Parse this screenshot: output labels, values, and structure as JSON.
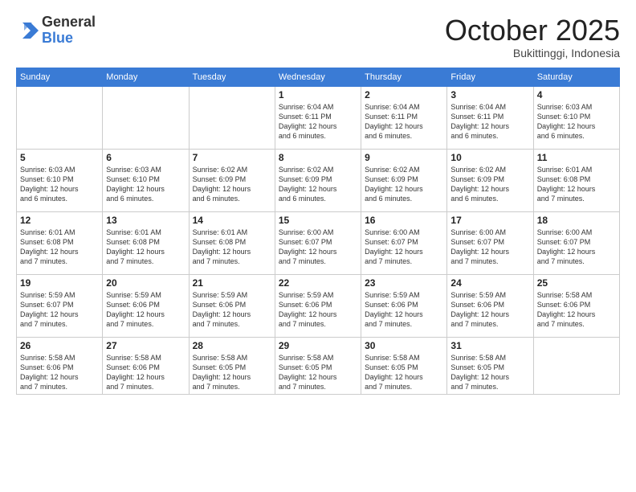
{
  "logo": {
    "general": "General",
    "blue": "Blue"
  },
  "header": {
    "month": "October 2025",
    "location": "Bukittinggi, Indonesia"
  },
  "weekdays": [
    "Sunday",
    "Monday",
    "Tuesday",
    "Wednesday",
    "Thursday",
    "Friday",
    "Saturday"
  ],
  "weeks": [
    [
      {
        "day": "",
        "info": ""
      },
      {
        "day": "",
        "info": ""
      },
      {
        "day": "",
        "info": ""
      },
      {
        "day": "1",
        "info": "Sunrise: 6:04 AM\nSunset: 6:11 PM\nDaylight: 12 hours\nand 6 minutes."
      },
      {
        "day": "2",
        "info": "Sunrise: 6:04 AM\nSunset: 6:11 PM\nDaylight: 12 hours\nand 6 minutes."
      },
      {
        "day": "3",
        "info": "Sunrise: 6:04 AM\nSunset: 6:11 PM\nDaylight: 12 hours\nand 6 minutes."
      },
      {
        "day": "4",
        "info": "Sunrise: 6:03 AM\nSunset: 6:10 PM\nDaylight: 12 hours\nand 6 minutes."
      }
    ],
    [
      {
        "day": "5",
        "info": "Sunrise: 6:03 AM\nSunset: 6:10 PM\nDaylight: 12 hours\nand 6 minutes."
      },
      {
        "day": "6",
        "info": "Sunrise: 6:03 AM\nSunset: 6:10 PM\nDaylight: 12 hours\nand 6 minutes."
      },
      {
        "day": "7",
        "info": "Sunrise: 6:02 AM\nSunset: 6:09 PM\nDaylight: 12 hours\nand 6 minutes."
      },
      {
        "day": "8",
        "info": "Sunrise: 6:02 AM\nSunset: 6:09 PM\nDaylight: 12 hours\nand 6 minutes."
      },
      {
        "day": "9",
        "info": "Sunrise: 6:02 AM\nSunset: 6:09 PM\nDaylight: 12 hours\nand 6 minutes."
      },
      {
        "day": "10",
        "info": "Sunrise: 6:02 AM\nSunset: 6:09 PM\nDaylight: 12 hours\nand 6 minutes."
      },
      {
        "day": "11",
        "info": "Sunrise: 6:01 AM\nSunset: 6:08 PM\nDaylight: 12 hours\nand 7 minutes."
      }
    ],
    [
      {
        "day": "12",
        "info": "Sunrise: 6:01 AM\nSunset: 6:08 PM\nDaylight: 12 hours\nand 7 minutes."
      },
      {
        "day": "13",
        "info": "Sunrise: 6:01 AM\nSunset: 6:08 PM\nDaylight: 12 hours\nand 7 minutes."
      },
      {
        "day": "14",
        "info": "Sunrise: 6:01 AM\nSunset: 6:08 PM\nDaylight: 12 hours\nand 7 minutes."
      },
      {
        "day": "15",
        "info": "Sunrise: 6:00 AM\nSunset: 6:07 PM\nDaylight: 12 hours\nand 7 minutes."
      },
      {
        "day": "16",
        "info": "Sunrise: 6:00 AM\nSunset: 6:07 PM\nDaylight: 12 hours\nand 7 minutes."
      },
      {
        "day": "17",
        "info": "Sunrise: 6:00 AM\nSunset: 6:07 PM\nDaylight: 12 hours\nand 7 minutes."
      },
      {
        "day": "18",
        "info": "Sunrise: 6:00 AM\nSunset: 6:07 PM\nDaylight: 12 hours\nand 7 minutes."
      }
    ],
    [
      {
        "day": "19",
        "info": "Sunrise: 5:59 AM\nSunset: 6:07 PM\nDaylight: 12 hours\nand 7 minutes."
      },
      {
        "day": "20",
        "info": "Sunrise: 5:59 AM\nSunset: 6:06 PM\nDaylight: 12 hours\nand 7 minutes."
      },
      {
        "day": "21",
        "info": "Sunrise: 5:59 AM\nSunset: 6:06 PM\nDaylight: 12 hours\nand 7 minutes."
      },
      {
        "day": "22",
        "info": "Sunrise: 5:59 AM\nSunset: 6:06 PM\nDaylight: 12 hours\nand 7 minutes."
      },
      {
        "day": "23",
        "info": "Sunrise: 5:59 AM\nSunset: 6:06 PM\nDaylight: 12 hours\nand 7 minutes."
      },
      {
        "day": "24",
        "info": "Sunrise: 5:59 AM\nSunset: 6:06 PM\nDaylight: 12 hours\nand 7 minutes."
      },
      {
        "day": "25",
        "info": "Sunrise: 5:58 AM\nSunset: 6:06 PM\nDaylight: 12 hours\nand 7 minutes."
      }
    ],
    [
      {
        "day": "26",
        "info": "Sunrise: 5:58 AM\nSunset: 6:06 PM\nDaylight: 12 hours\nand 7 minutes."
      },
      {
        "day": "27",
        "info": "Sunrise: 5:58 AM\nSunset: 6:06 PM\nDaylight: 12 hours\nand 7 minutes."
      },
      {
        "day": "28",
        "info": "Sunrise: 5:58 AM\nSunset: 6:05 PM\nDaylight: 12 hours\nand 7 minutes."
      },
      {
        "day": "29",
        "info": "Sunrise: 5:58 AM\nSunset: 6:05 PM\nDaylight: 12 hours\nand 7 minutes."
      },
      {
        "day": "30",
        "info": "Sunrise: 5:58 AM\nSunset: 6:05 PM\nDaylight: 12 hours\nand 7 minutes."
      },
      {
        "day": "31",
        "info": "Sunrise: 5:58 AM\nSunset: 6:05 PM\nDaylight: 12 hours\nand 7 minutes."
      },
      {
        "day": "",
        "info": ""
      }
    ]
  ]
}
